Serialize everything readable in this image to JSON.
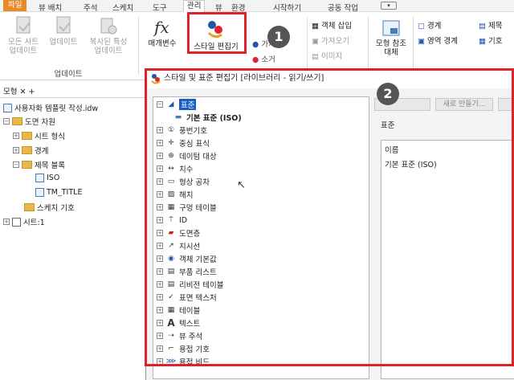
{
  "menubar": {
    "tabs": [
      "파일",
      "뷰 배치",
      "주석",
      "스케치",
      "도구",
      "관리",
      "뷰",
      "환경",
      "시작하기",
      "공동 작업"
    ],
    "active": "파일",
    "selected": "관리"
  },
  "ribbon": {
    "update_all_sheets": "모든 시트\n업데이트",
    "update": "업데이트",
    "update_copied_props": "복사된 특성\n업데이트",
    "group_update": "업데이트",
    "param": "매개변수",
    "style_editor": "스타일 편집기",
    "style_small1": "가져",
    "style_small2": "소거",
    "insert_object": "객체 삽입",
    "import": "가져오기",
    "image": "이미지",
    "model_ref": "모형 참조\n대체",
    "boundary": "경계",
    "area_boundary": "영역 경계",
    "right1": "제목",
    "right2": "기호"
  },
  "leftpanel": {
    "tab": "모형",
    "items": [
      {
        "label": "사용자화 템플릿 작성.idw"
      },
      {
        "label": "도면 자원"
      },
      {
        "label": "시트 형식"
      },
      {
        "label": "경계"
      },
      {
        "label": "제목 블록"
      },
      {
        "label": "ISO"
      },
      {
        "label": "TM_TITLE"
      },
      {
        "label": "스케치 기호"
      },
      {
        "label": "시트:1"
      }
    ]
  },
  "dialog": {
    "title": "스타일 및 표준 편집기 [라이브러리 - 읽기/쓰기]",
    "new_btn": "새로 만들기...",
    "section": "표준",
    "prop_name_header": "이름",
    "prop_name_value": "기본 표준 (ISO)",
    "tree": [
      {
        "label": "표준",
        "icon": "standard-icon"
      },
      {
        "label": "기본 표준 (ISO)",
        "icon": "standard-doc-icon"
      },
      {
        "label": "풍번기호",
        "icon": "balloon-icon"
      },
      {
        "label": "중심 표식",
        "icon": "center-mark-icon"
      },
      {
        "label": "데이텀 대상",
        "icon": "datum-target-icon"
      },
      {
        "label": "치수",
        "icon": "dimension-icon"
      },
      {
        "label": "형상 공차",
        "icon": "tolerance-icon"
      },
      {
        "label": "해치",
        "icon": "hatch-icon"
      },
      {
        "label": "구멍 테이블",
        "icon": "hole-table-icon"
      },
      {
        "label": "ID",
        "icon": "id-icon"
      },
      {
        "label": "도면층",
        "icon": "layer-icon"
      },
      {
        "label": "지시선",
        "icon": "leader-icon"
      },
      {
        "label": "객체 기본값",
        "icon": "object-defaults-icon"
      },
      {
        "label": "부품 리스트",
        "icon": "parts-list-icon"
      },
      {
        "label": "리비전 테이블",
        "icon": "revision-table-icon"
      },
      {
        "label": "표면 텍스처",
        "icon": "surface-texture-icon"
      },
      {
        "label": "테이블",
        "icon": "table-icon"
      },
      {
        "label": "텍스트",
        "icon": "text-icon"
      },
      {
        "label": "뷰 주석",
        "icon": "view-annotation-icon"
      },
      {
        "label": "용접 기호",
        "icon": "weld-symbol-icon"
      },
      {
        "label": "용접 비드",
        "icon": "weld-bead-icon"
      }
    ]
  },
  "badges": {
    "one": "1",
    "two": "2"
  },
  "colors": {
    "accent": "#e88a2a",
    "highlight": "#e0202a",
    "badge": "#555555"
  }
}
